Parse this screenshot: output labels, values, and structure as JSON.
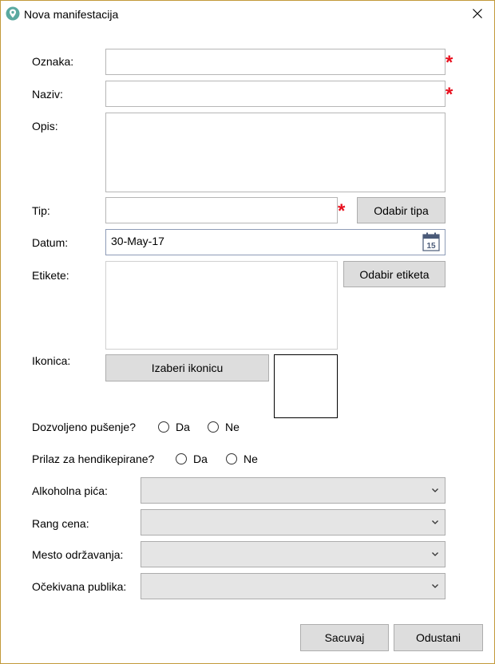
{
  "window": {
    "title": "Nova manifestacija"
  },
  "form": {
    "oznaka_label": "Oznaka:",
    "oznaka_value": "",
    "naziv_label": "Naziv:",
    "naziv_value": "",
    "opis_label": "Opis:",
    "opis_value": "",
    "tip_label": "Tip:",
    "tip_value": "",
    "tip_button": "Odabir tipa",
    "datum_label": "Datum:",
    "datum_value": "30-May-17",
    "etikete_label": "Etikete:",
    "etikete_button": "Odabir etiketa",
    "ikonica_label": "Ikonica:",
    "ikonica_button": "Izaberi ikonicu",
    "required_mark": "*"
  },
  "radios": {
    "pusenje_label": "Dozvoljeno pušenje?",
    "hendikep_label": "Prilaz za hendikepirane?",
    "da": "Da",
    "ne": "Ne"
  },
  "combos": [
    {
      "label": "Alkoholna pića:",
      "value": ""
    },
    {
      "label": "Rang cena:",
      "value": ""
    },
    {
      "label": "Mesto održavanja:",
      "value": ""
    },
    {
      "label": "Očekivana publika:",
      "value": ""
    }
  ],
  "buttons": {
    "save": "Sacuvaj",
    "cancel": "Odustani"
  },
  "icons": {
    "app": "location-pin-icon",
    "close": "close-icon",
    "calendar": "calendar-icon",
    "dropdown": "chevron-down-icon"
  },
  "colors": {
    "required": "#e8101e",
    "window_border": "#c29a3a",
    "button_bg": "#dddddd",
    "app_icon": "#5aa9a0"
  }
}
